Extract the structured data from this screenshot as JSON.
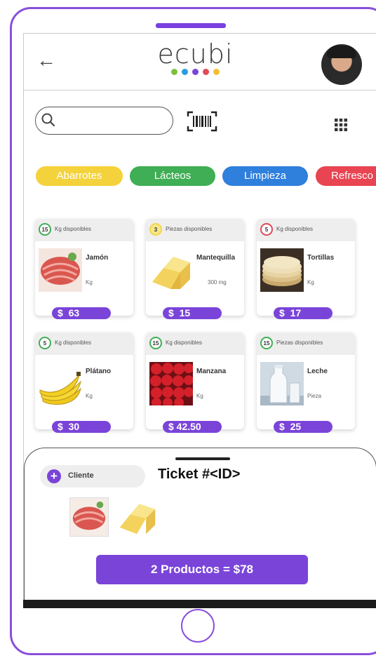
{
  "app": {
    "logo_text": "ecubi",
    "logo_dot_colors": [
      "#7fbf3f",
      "#2e9be0",
      "#7a44d9",
      "#e24a5a",
      "#f2c037"
    ]
  },
  "header": {
    "back_icon": "arrow-left-icon",
    "avatar": "user-avatar"
  },
  "search": {
    "value": "",
    "icon": "search-icon",
    "barcode_icon": "barcode-scan-icon",
    "grid_icon": "grid-view-icon"
  },
  "categories": [
    {
      "label": "Abarrotes",
      "color": "#f4d23c"
    },
    {
      "label": "Lácteos",
      "color": "#3fae54"
    },
    {
      "label": "Limpieza",
      "color": "#2f7fdc"
    },
    {
      "label": "Refresco",
      "color": "#e84451"
    }
  ],
  "products": [
    {
      "count": "15",
      "badge_color": "#3fae54",
      "availability": "Kg disponibles",
      "name": "Jamón",
      "unit": "Kg",
      "price": "$  63",
      "image": "ham"
    },
    {
      "count": "3",
      "badge_color": "#f2d64b",
      "availability": "Piezas disponibles",
      "name": "Mantequilla",
      "unit": "300 mg",
      "price": "$  15",
      "image": "butter"
    },
    {
      "count": "5",
      "badge_color": "#e04a5a",
      "availability": "Kg disponibles",
      "name": "Tortillas",
      "unit": "Kg",
      "price": "$  17",
      "image": "tortillas"
    },
    {
      "count": "5",
      "badge_color": "#3fae54",
      "availability": "Kg disponibles",
      "name": "Plátano",
      "unit": "Kg",
      "price": "$  30",
      "image": "banana"
    },
    {
      "count": "15",
      "badge_color": "#3fae54",
      "availability": "Kg disponibles",
      "name": "Manzana",
      "unit": "Kg",
      "price": "$ 42.50",
      "image": "apple"
    },
    {
      "count": "15",
      "badge_color": "#3fae54",
      "availability": "Piezas disponibles",
      "name": "Leche",
      "unit": "Pieza",
      "price": "$  25",
      "image": "milk"
    }
  ],
  "ticket": {
    "client_label": "Cliente",
    "title": "Ticket #<ID>",
    "items": [
      "ham",
      "butter"
    ],
    "total_label": "2 Productos = $78"
  }
}
